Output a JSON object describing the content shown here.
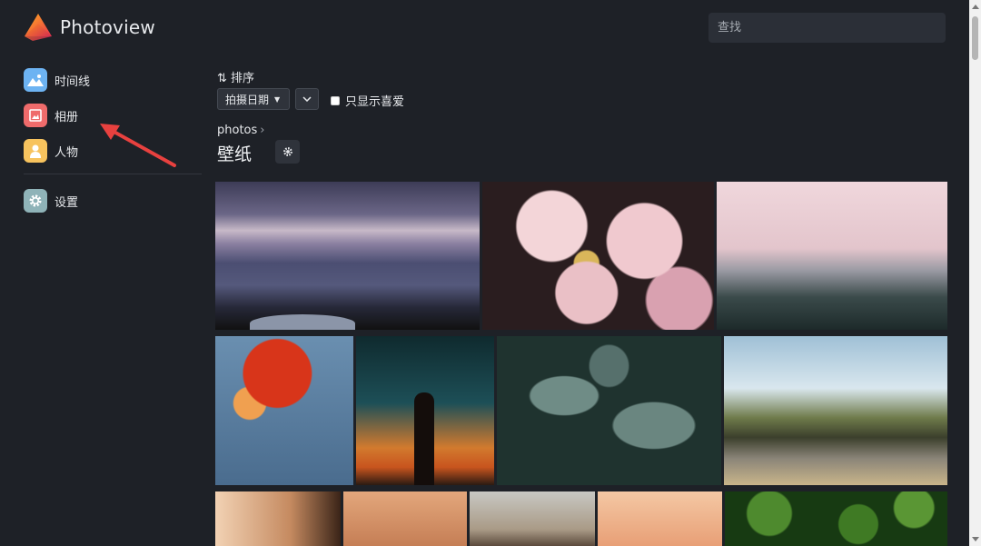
{
  "app": {
    "title": "Photoview"
  },
  "search": {
    "placeholder": "查找"
  },
  "sidebar": {
    "items": [
      {
        "label": "时间线",
        "icon": "timeline-icon",
        "color": "#6db3f2"
      },
      {
        "label": "相册",
        "icon": "album-icon",
        "color": "#ef6b6b"
      },
      {
        "label": "人物",
        "icon": "people-icon",
        "color": "#f7c35e"
      },
      {
        "label": "设置",
        "icon": "gear-icon",
        "color": "#8fb3b8"
      }
    ]
  },
  "controls": {
    "sort_label": "排序",
    "sort_value": "拍摄日期",
    "favorites_label": "只显示喜爱"
  },
  "album": {
    "breadcrumb": "photos",
    "title": "壁纸"
  },
  "colors": {
    "background": "#1e2127",
    "annotation_arrow": "#e8413f"
  }
}
